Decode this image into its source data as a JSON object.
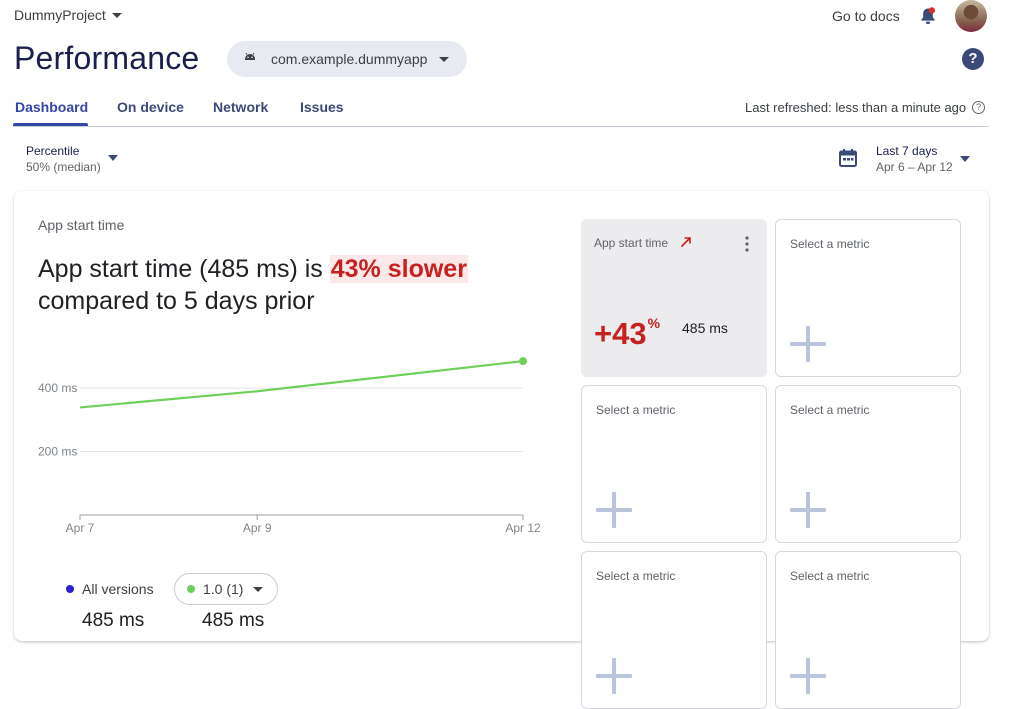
{
  "header": {
    "project": "DummyProject",
    "docs_link": "Go to docs",
    "title": "Performance",
    "app_selector": "com.example.dummyapp",
    "help_glyph": "?"
  },
  "tabs": [
    {
      "label": "Dashboard",
      "active": true
    },
    {
      "label": "On device",
      "active": false
    },
    {
      "label": "Network",
      "active": false
    },
    {
      "label": "Issues",
      "active": false
    }
  ],
  "last_refreshed": "Last refreshed: less than a minute ago",
  "filters": {
    "percentile_label": "Percentile",
    "percentile_value": "50% (median)",
    "range_label": "Last 7 days",
    "range_value": "Apr 6 – Apr 12"
  },
  "metric": {
    "name": "App start time",
    "headline_prefix": "App start time (485 ms) is ",
    "headline_highlight": "43% slower",
    "headline_suffix": "compared to 5 days prior"
  },
  "chart_data": {
    "type": "line",
    "x": [
      "Apr 7",
      "Apr 9",
      "Apr 12"
    ],
    "x_ticks": [
      "Apr 7",
      "Apr 9",
      "Apr 12"
    ],
    "y_ticks": [
      "400 ms",
      "200 ms"
    ],
    "series": [
      {
        "name": "1.0 (1)",
        "color": "#6fcf5b",
        "values": [
          339,
          390,
          485
        ]
      }
    ],
    "ylim": [
      0,
      520
    ],
    "grid": true
  },
  "legend": {
    "all_versions": "All versions",
    "version": "1.0 (1)",
    "all_versions_value": "485 ms",
    "version_value": "485 ms"
  },
  "tiles": {
    "active_label": "App start time",
    "active_change_prefix": "+43",
    "active_change_unit": "%",
    "active_value": "485 ms",
    "empty_label": "Select a metric"
  },
  "colors": {
    "accent": "#3346a6",
    "regression": "#c5221f",
    "series_green": "#6fcf5b",
    "series_all": "#2d1fd0"
  }
}
